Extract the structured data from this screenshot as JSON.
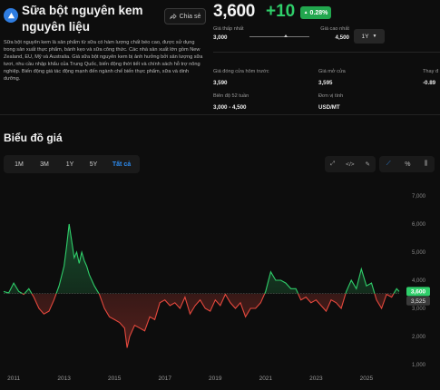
{
  "header": {
    "title": "Sữa bột nguyên kem nguyên liệu",
    "share_label": "Chia sẻ",
    "description": "Sữa bột nguyên kem là sản phẩm từ sữa có hàm lượng chất béo cao, được sử dụng trong sản xuất thực phẩm, bánh kẹo và sữa công thức. Các nhà sản xuất lớn gồm New Zealand, EU, Mỹ và Australia. Giá sữa bột nguyên kem bị ảnh hưởng bởi sản lượng sữa tươi, nhu cầu nhập khẩu của Trung Quốc, biến động thời tiết và chính sách hỗ trợ nông nghiệp. Biến động giá tác động mạnh đến ngành chế biến thực phẩm, sữa và dinh dưỡng."
  },
  "quote": {
    "price": "3,600",
    "change": "+10",
    "change_pct": "0.28%",
    "range_low_label": "Giá thấp nhất",
    "range_low": "3,000",
    "range_high_label": "Giá cao nhất",
    "range_high": "4,500",
    "range_position": 0.6,
    "period": "1Y"
  },
  "stats": {
    "prev_close_label": "Giá đóng cửa hôm trước",
    "prev_close": "3,590",
    "open_label": "Giá mở cửa",
    "open": "3,595",
    "change_label": "Thay đ",
    "change_value": "-0.89",
    "range52_label": "Biên độ 52 tuần",
    "range52": "3,000 - 4,500",
    "unit_label": "Đơn vị tính",
    "unit": "USD/MT"
  },
  "chart_section": {
    "title": "Biểu đồ giá",
    "tabs": [
      "1M",
      "3M",
      "1Y",
      "5Y",
      "Tất cả"
    ],
    "active_tab": "Tất cả",
    "tool_icons": [
      "expand-icon",
      "embed-icon",
      "draw-icon"
    ],
    "mode_icons": [
      "line-chart-icon",
      "percent-icon",
      "candlestick-icon"
    ]
  },
  "colors": {
    "up": "#2fce6a",
    "down": "#e5483d",
    "accent": "#2d8cf0",
    "background": "#0d0d0d"
  },
  "chart_data": {
    "type": "line",
    "baseline": 3525,
    "current_value": 3600,
    "current_label": "3,600",
    "baseline_label": "3,525",
    "x_ticks": [
      "2011",
      "2013",
      "2015",
      "2017",
      "2019",
      "2021",
      "2023",
      "2025"
    ],
    "y_ticks": [
      "7,000",
      "6,000",
      "5,000",
      "4,000",
      "3,000",
      "2,000",
      "1,000"
    ],
    "ylim": [
      1000,
      7000
    ],
    "xlim": [
      2010.6,
      2026.3
    ],
    "x": [
      2010.6,
      2010.8,
      2011.0,
      2011.2,
      2011.4,
      2011.6,
      2011.8,
      2012.0,
      2012.2,
      2012.4,
      2012.6,
      2012.8,
      2013.0,
      2013.1,
      2013.2,
      2013.3,
      2013.4,
      2013.5,
      2013.6,
      2013.7,
      2013.8,
      2013.9,
      2014.0,
      2014.2,
      2014.4,
      2014.6,
      2014.8,
      2015.0,
      2015.2,
      2015.4,
      2015.5,
      2015.6,
      2015.8,
      2016.0,
      2016.2,
      2016.4,
      2016.6,
      2016.8,
      2017.0,
      2017.2,
      2017.4,
      2017.6,
      2017.8,
      2018.0,
      2018.2,
      2018.4,
      2018.6,
      2018.8,
      2019.0,
      2019.2,
      2019.4,
      2019.6,
      2019.8,
      2020.0,
      2020.2,
      2020.4,
      2020.6,
      2020.8,
      2021.0,
      2021.2,
      2021.4,
      2021.6,
      2021.8,
      2022.0,
      2022.2,
      2022.4,
      2022.6,
      2022.8,
      2023.0,
      2023.2,
      2023.4,
      2023.6,
      2023.8,
      2024.0,
      2024.2,
      2024.4,
      2024.6,
      2024.8,
      2025.0,
      2025.2,
      2025.4,
      2025.6,
      2025.8,
      2026.0,
      2026.2,
      2026.3
    ],
    "y": [
      3600,
      3550,
      3900,
      3600,
      3500,
      3700,
      3400,
      3000,
      2800,
      2900,
      3300,
      3800,
      4500,
      5200,
      6000,
      5400,
      4800,
      5000,
      4600,
      5000,
      4700,
      4500,
      4200,
      3800,
      3500,
      3000,
      2700,
      2600,
      2500,
      2300,
      1600,
      2000,
      2400,
      2300,
      2200,
      2700,
      2600,
      3200,
      3300,
      3100,
      3200,
      3000,
      3400,
      2800,
      3100,
      3300,
      3000,
      2900,
      3300,
      3100,
      3500,
      3200,
      3000,
      3200,
      2700,
      3000,
      3000,
      3200,
      3600,
      4300,
      4000,
      4000,
      3900,
      3700,
      3700,
      3300,
      3400,
      3200,
      3300,
      3100,
      2900,
      3300,
      3200,
      3000,
      3600,
      4000,
      3700,
      4400,
      3800,
      3900,
      3300,
      3000,
      3500,
      3400,
      3700,
      3600
    ],
    "grid": false,
    "legend": "none"
  }
}
